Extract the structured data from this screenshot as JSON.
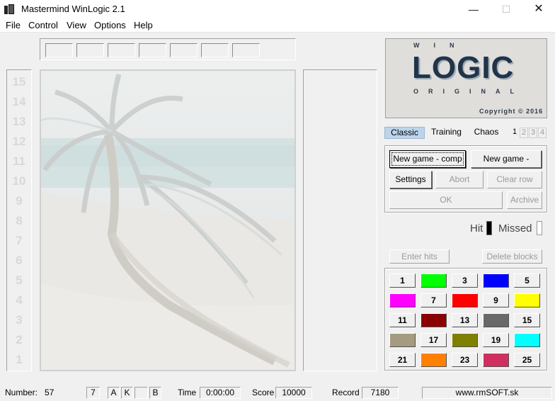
{
  "window": {
    "title": "Mastermind WinLogic 2.1",
    "minimize": "—",
    "maximize": "☐",
    "close": "✕"
  },
  "menu": [
    "File",
    "Control",
    "View",
    "Options",
    "Help"
  ],
  "rows": [
    "15",
    "14",
    "13",
    "12",
    "11",
    "10",
    "9",
    "8",
    "7",
    "6",
    "5",
    "4",
    "3",
    "2",
    "1"
  ],
  "logo": {
    "top": "WIN",
    "main": "LOGIC",
    "bottom": "ORIGINAL",
    "copyright": "Copyright © 2016"
  },
  "modes": {
    "tabs": [
      "Classic",
      "Training",
      "Chaos"
    ],
    "active": "Classic",
    "levels": [
      "1",
      "2",
      "3",
      "4"
    ]
  },
  "buttons": {
    "new_game_comp": "New game - comp",
    "new_game_player": "New game - player",
    "settings": "Settings",
    "abort": "Abort",
    "clear_row": "Clear row",
    "ok": "OK",
    "archive": "Archive",
    "enter_hits": "Enter hits",
    "delete_blocks": "Delete blocks"
  },
  "hit_label": "Hit",
  "missed_label": "Missed",
  "palette": [
    {
      "label": "1",
      "color": ""
    },
    {
      "label": "",
      "color": "#00ff00"
    },
    {
      "label": "3",
      "color": ""
    },
    {
      "label": "",
      "color": "#0000ff"
    },
    {
      "label": "5",
      "color": ""
    },
    {
      "label": "",
      "color": "#ff00ff"
    },
    {
      "label": "7",
      "color": ""
    },
    {
      "label": "",
      "color": "#ff0000"
    },
    {
      "label": "9",
      "color": ""
    },
    {
      "label": "",
      "color": "#ffff00"
    },
    {
      "label": "11",
      "color": ""
    },
    {
      "label": "",
      "color": "#8b0000"
    },
    {
      "label": "13",
      "color": ""
    },
    {
      "label": "",
      "color": "#696969"
    },
    {
      "label": "15",
      "color": ""
    },
    {
      "label": "",
      "color": "#a59b80"
    },
    {
      "label": "17",
      "color": ""
    },
    {
      "label": "",
      "color": "#808000"
    },
    {
      "label": "19",
      "color": ""
    },
    {
      "label": "",
      "color": "#00ffff"
    },
    {
      "label": "21",
      "color": ""
    },
    {
      "label": "",
      "color": "#ff8000"
    },
    {
      "label": "23",
      "color": ""
    },
    {
      "label": "",
      "color": "#d03060"
    },
    {
      "label": "25",
      "color": ""
    }
  ],
  "status": {
    "number_label": "Number:",
    "number": "57",
    "f1": "7",
    "f2": "A",
    "f3": "K",
    "f4": "",
    "f5": "B",
    "time_label": "Time",
    "time": "0:00:00",
    "score_label": "Score",
    "score": "10000",
    "record_label": "Record",
    "record": "7180",
    "website": "www.rmSOFT.sk"
  }
}
